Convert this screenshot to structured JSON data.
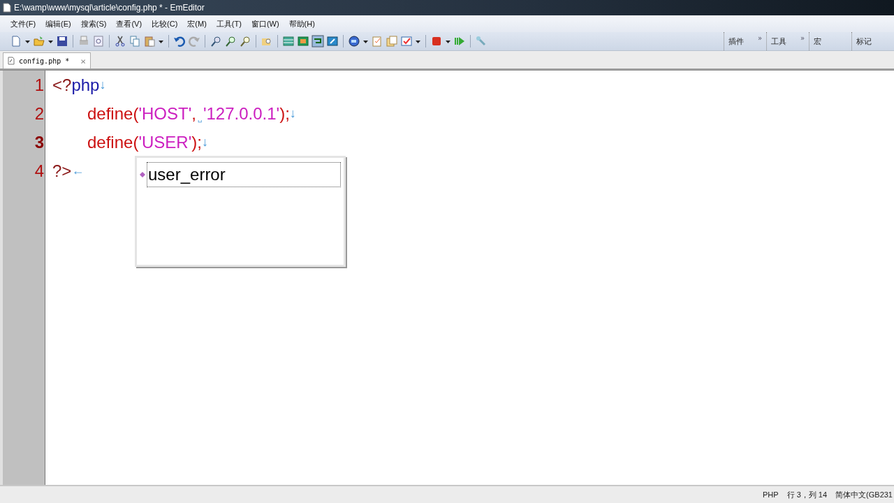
{
  "window": {
    "title": "E:\\wamp\\www\\mysql\\article\\config.php * - EmEditor"
  },
  "menu": [
    "文件(F)",
    "编辑(E)",
    "搜索(S)",
    "查看(V)",
    "比较(C)",
    "宏(M)",
    "工具(T)",
    "窗口(W)",
    "帮助(H)"
  ],
  "toolbar_bands": [
    {
      "label": "插件",
      "more": "»"
    },
    {
      "label": "工具",
      "more": "»"
    },
    {
      "label": "宏"
    },
    {
      "label": "标记"
    }
  ],
  "tabs": [
    {
      "label": "config.php *",
      "selected": true,
      "close": "×"
    }
  ],
  "editor": {
    "lines": [
      {
        "number": "1",
        "current": false,
        "indented": false,
        "tokens": [
          {
            "kind": "tag",
            "text": "<?"
          },
          {
            "kind": "keyword",
            "text": "php"
          },
          {
            "kind": "mark",
            "text": "↓"
          }
        ]
      },
      {
        "number": "2",
        "current": false,
        "indented": true,
        "tokens": [
          {
            "kind": "func",
            "text": "define("
          },
          {
            "kind": "str",
            "text": "'HOST'"
          },
          {
            "kind": "func",
            "text": ","
          },
          {
            "kind": "space",
            "text": "␣"
          },
          {
            "kind": "str",
            "text": "'127.0.0.1'"
          },
          {
            "kind": "func",
            "text": ");"
          },
          {
            "kind": "mark",
            "text": "↓"
          }
        ]
      },
      {
        "number": "3",
        "current": true,
        "indented": true,
        "tokens": [
          {
            "kind": "func",
            "text": "define("
          },
          {
            "kind": "str",
            "text": "'USER'"
          },
          {
            "kind": "func",
            "text": ");"
          },
          {
            "kind": "mark",
            "text": "↓"
          }
        ]
      },
      {
        "number": "4",
        "current": false,
        "indented": false,
        "tokens": [
          {
            "kind": "tag",
            "text": "?>"
          },
          {
            "kind": "mark",
            "text": "←"
          }
        ]
      }
    ],
    "completion": {
      "items": [
        {
          "label": "user_error",
          "selected": true
        }
      ]
    }
  },
  "status_bar": {
    "mode": "PHP",
    "position": "行 3，列 14",
    "encoding": "简体中文(GB231"
  }
}
